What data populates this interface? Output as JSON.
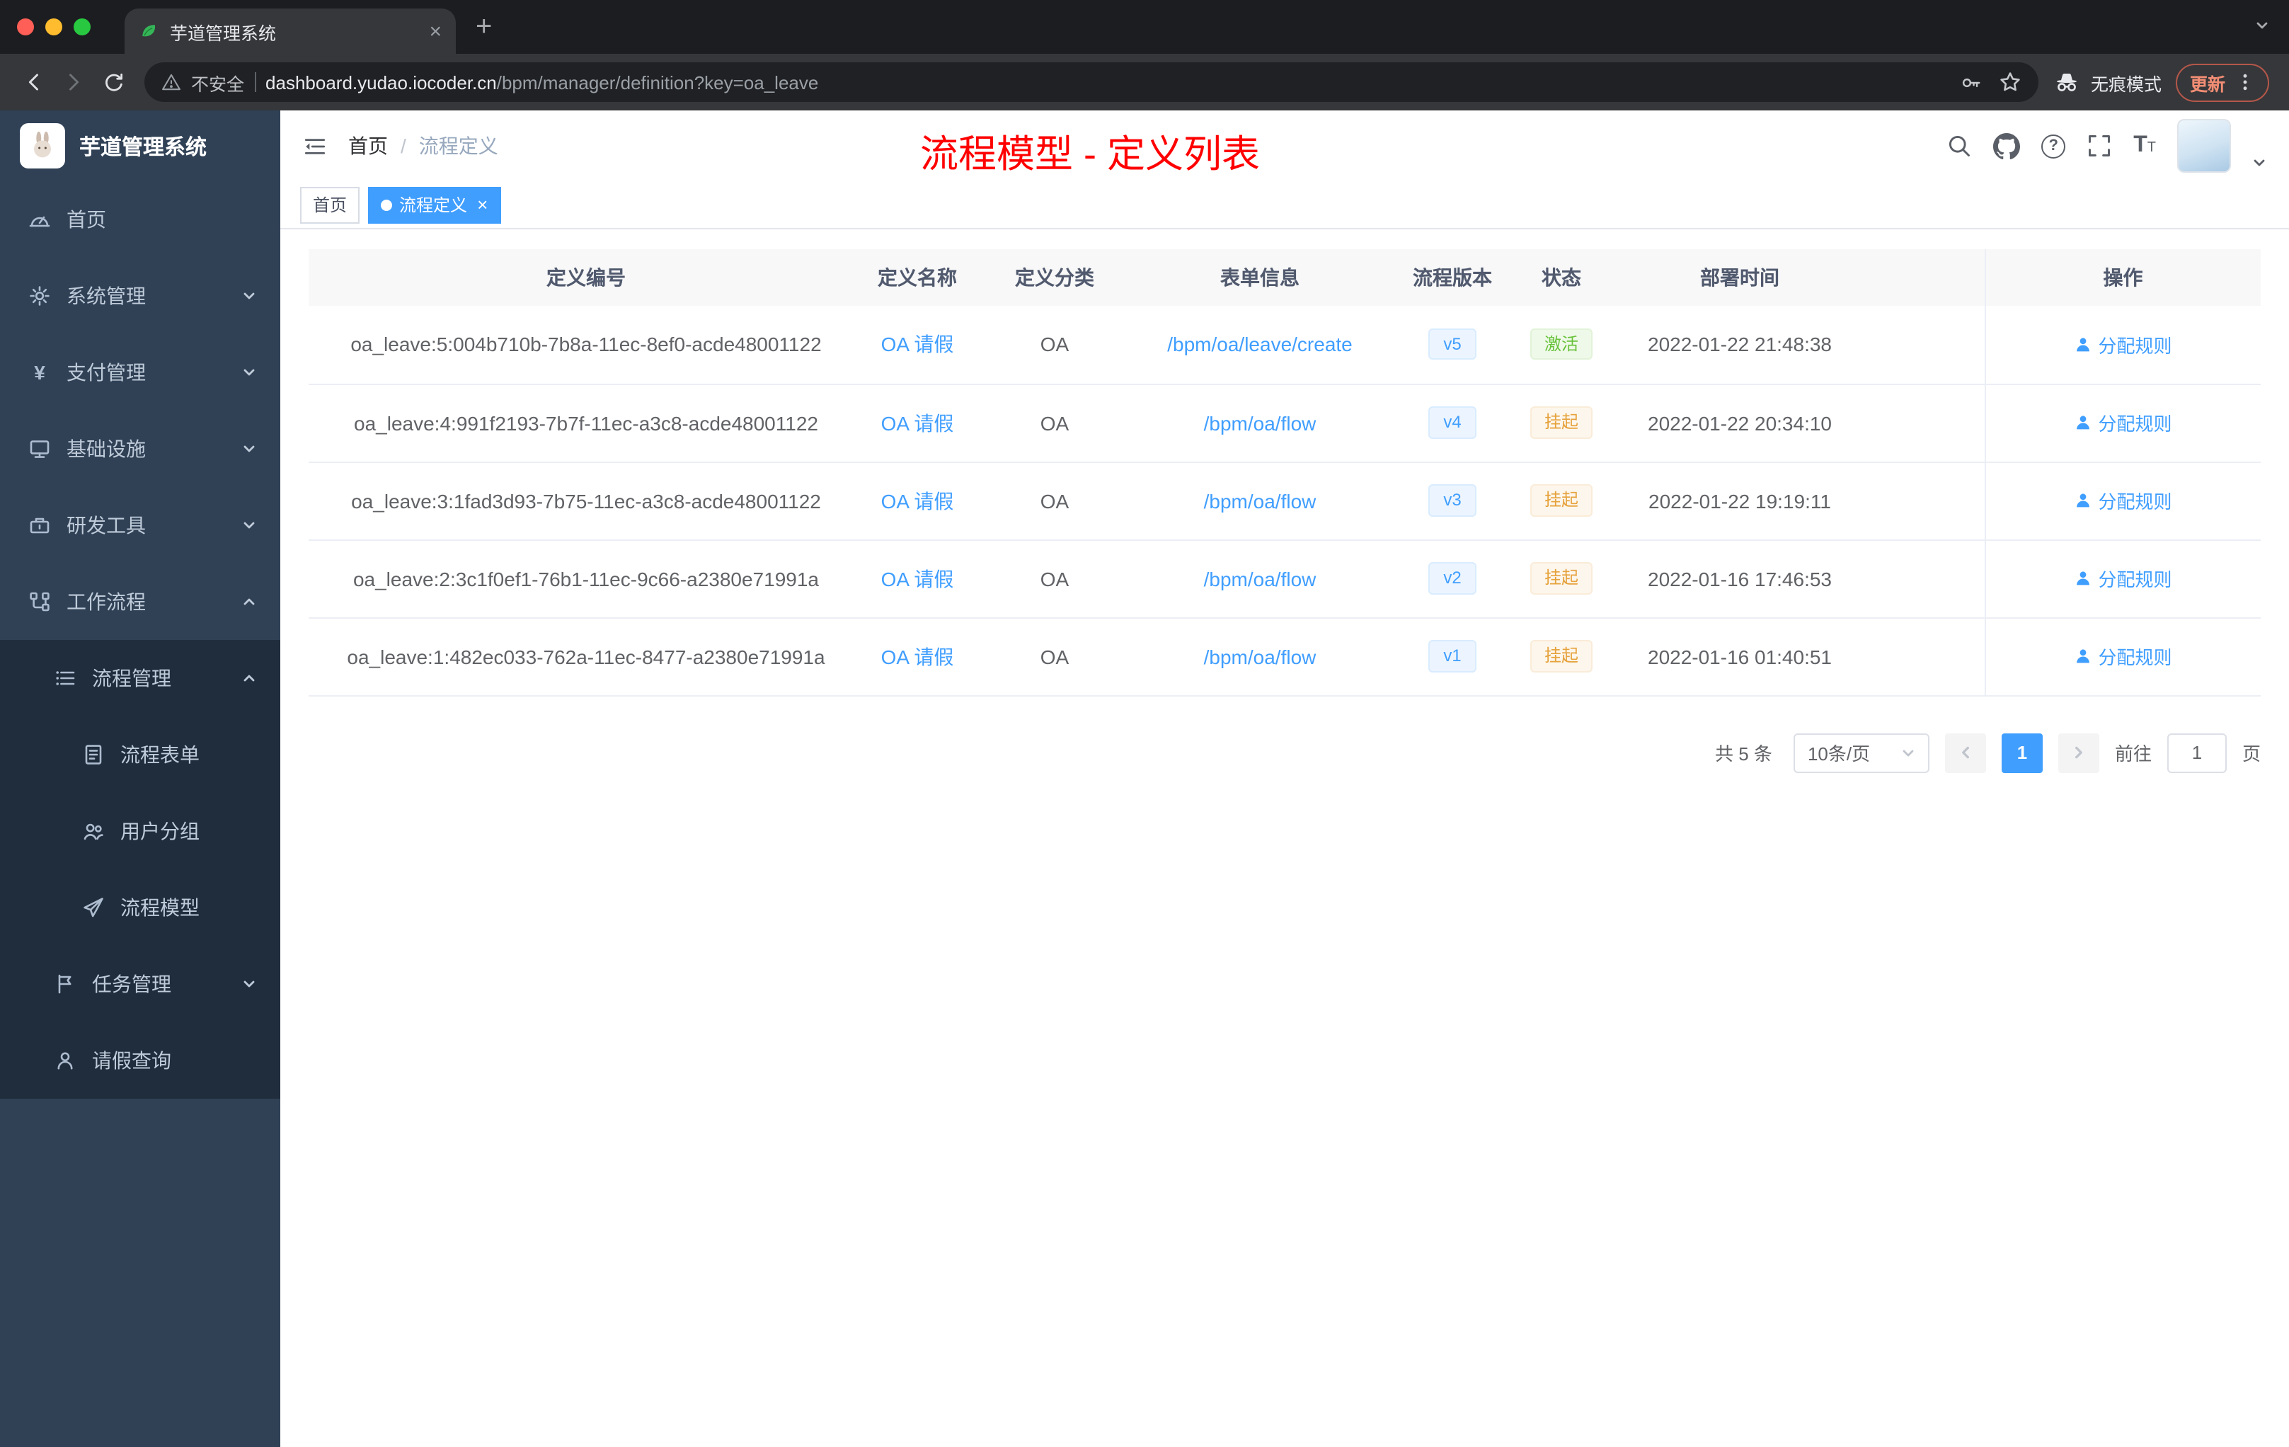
{
  "colors": {
    "accent": "#409eff",
    "success": "#67c23a",
    "warning": "#e6a23c",
    "annotation_red": "#ff0000",
    "sidebar_bg": "#304156",
    "submenu_bg": "#1f2d3d",
    "active_tag_bg": "#409eff"
  },
  "icons": {
    "question_glyph": "?",
    "close_glyph": "×",
    "plus_glyph": "+",
    "fontsize_glyph": "T"
  },
  "browser": {
    "tab_title": "芋道管理系统",
    "security_label": "不安全",
    "url_host": "dashboard.yudao.iocoder.cn",
    "url_path": "/bpm/manager/definition?key=oa_leave",
    "incognito_label": "无痕模式",
    "update_label": "更新"
  },
  "sidebar": {
    "logo_title": "芋道管理系统",
    "items": [
      {
        "label": "首页",
        "icon": "dashboard",
        "level": 1
      },
      {
        "label": "系统管理",
        "icon": "gear",
        "level": 1,
        "chevron": "down"
      },
      {
        "label": "支付管理",
        "icon": "yen",
        "level": 1,
        "chevron": "down"
      },
      {
        "label": "基础设施",
        "icon": "monitor",
        "level": 1,
        "chevron": "down"
      },
      {
        "label": "研发工具",
        "icon": "tool",
        "level": 1,
        "chevron": "down"
      },
      {
        "label": "工作流程",
        "icon": "workflow",
        "level": 1,
        "chevron": "up"
      },
      {
        "label": "流程管理",
        "icon": "list",
        "level": 2,
        "chevron": "up",
        "sub": true
      },
      {
        "label": "流程表单",
        "icon": "form",
        "level": 3,
        "sub": true
      },
      {
        "label": "用户分组",
        "icon": "users",
        "level": 3,
        "sub": true
      },
      {
        "label": "流程模型",
        "icon": "plane",
        "level": 3,
        "sub": true
      },
      {
        "label": "任务管理",
        "icon": "task",
        "level": 2,
        "chevron": "down",
        "sub": true
      },
      {
        "label": "请假查询",
        "icon": "user",
        "level": 2,
        "sub": true
      }
    ]
  },
  "header": {
    "breadcrumb": [
      "首页",
      "流程定义"
    ],
    "separator": "/",
    "annotation": "流程模型 - 定义列表"
  },
  "tags": [
    {
      "label": "首页",
      "active": false,
      "closable": false
    },
    {
      "label": "流程定义",
      "active": true,
      "closable": true
    }
  ],
  "table": {
    "columns": [
      "定义编号",
      "定义名称",
      "定义分类",
      "表单信息",
      "流程版本",
      "状态",
      "部署时间",
      "操作"
    ],
    "rows": [
      {
        "id": "oa_leave:5:004b710b-7b8a-11ec-8ef0-acde48001122",
        "name": "OA 请假",
        "category": "OA",
        "form": "/bpm/oa/leave/create",
        "version": "v5",
        "status": "激活",
        "status_type": "success",
        "time": "2022-01-22 21:48:38",
        "action": "分配规则"
      },
      {
        "id": "oa_leave:4:991f2193-7b7f-11ec-a3c8-acde48001122",
        "name": "OA 请假",
        "category": "OA",
        "form": "/bpm/oa/flow",
        "version": "v4",
        "status": "挂起",
        "status_type": "warning",
        "time": "2022-01-22 20:34:10",
        "action": "分配规则"
      },
      {
        "id": "oa_leave:3:1fad3d93-7b75-11ec-a3c8-acde48001122",
        "name": "OA 请假",
        "category": "OA",
        "form": "/bpm/oa/flow",
        "version": "v3",
        "status": "挂起",
        "status_type": "warning",
        "time": "2022-01-22 19:19:11",
        "action": "分配规则"
      },
      {
        "id": "oa_leave:2:3c1f0ef1-76b1-11ec-9c66-a2380e71991a",
        "name": "OA 请假",
        "category": "OA",
        "form": "/bpm/oa/flow",
        "version": "v2",
        "status": "挂起",
        "status_type": "warning",
        "time": "2022-01-16 17:46:53",
        "action": "分配规则"
      },
      {
        "id": "oa_leave:1:482ec033-762a-11ec-8477-a2380e71991a",
        "name": "OA 请假",
        "category": "OA",
        "form": "/bpm/oa/flow",
        "version": "v1",
        "status": "挂起",
        "status_type": "warning",
        "time": "2022-01-16 01:40:51",
        "action": "分配规则"
      }
    ]
  },
  "pagination": {
    "total": "共 5 条",
    "page_size": "10条/页",
    "current_page": "1",
    "goto_label": "前往",
    "goto_value": "1",
    "page_unit": "页"
  }
}
